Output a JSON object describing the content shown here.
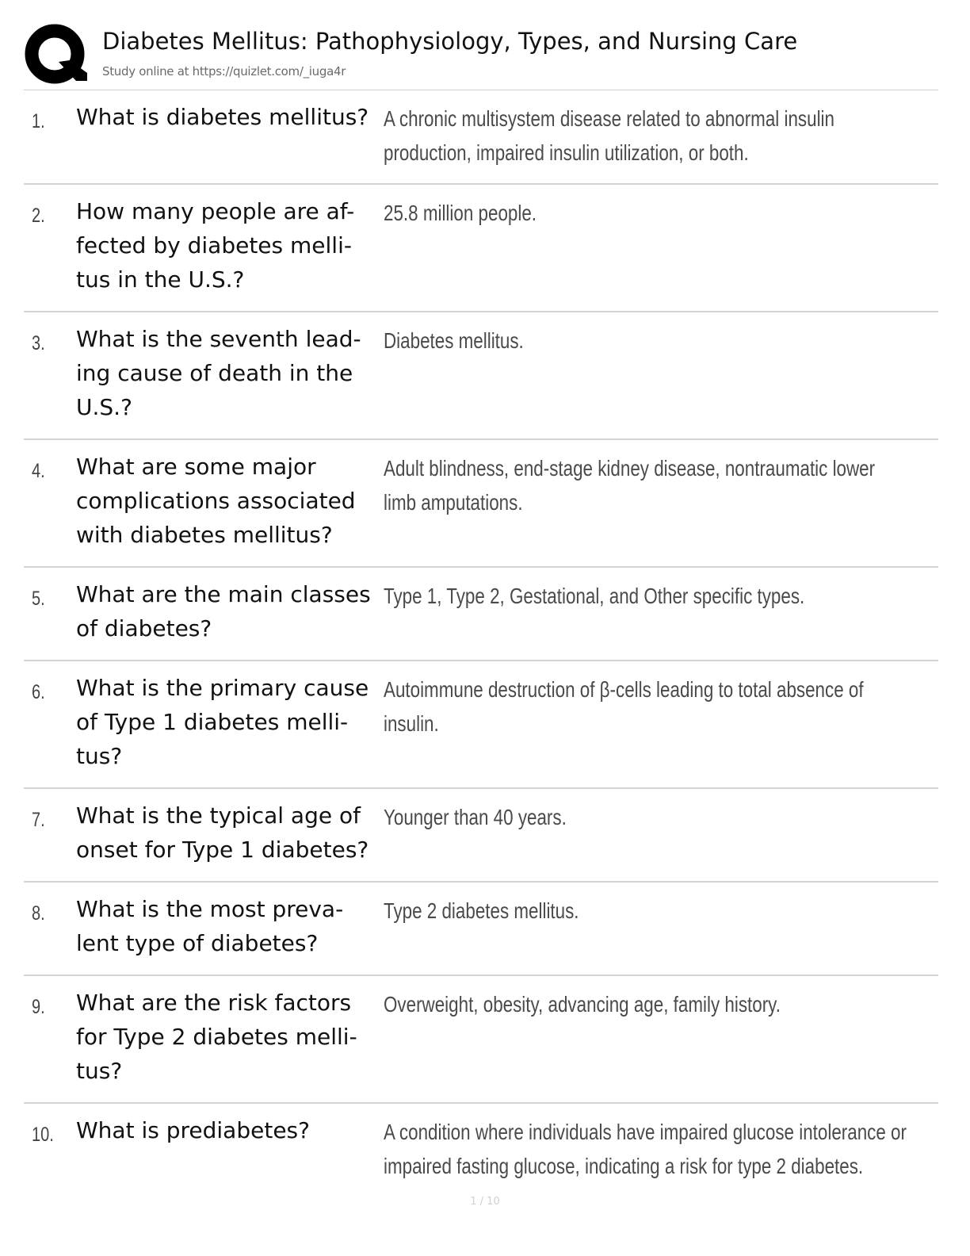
{
  "header": {
    "logo_icon": "quizlet-q-logo-icon",
    "title": "Diabetes Mellitus: Pathophysiology, Types, and Nursing Care",
    "subtitle": "Study online at https://quizlet.com/_iuga4r"
  },
  "cards": [
    {
      "number": "1.",
      "term": "What is diabetes mellitus?",
      "definition": "A chronic multisystem disease related to abnormal insulin production, impaired insulin utilization, or both."
    },
    {
      "number": "2.",
      "term": "How many people are af-fected by diabetes melli-tus in the U.S.?",
      "definition": "25.8 million people."
    },
    {
      "number": "3.",
      "term": "What is the seventh lead-ing cause of death in the U.S.?",
      "definition": "Diabetes mellitus."
    },
    {
      "number": "4.",
      "term": "What are some major complications associated with diabetes mellitus?",
      "definition": "Adult blindness, end-stage kidney disease, nontraumatic lower limb amputations."
    },
    {
      "number": "5.",
      "term": "What are the main classes of diabetes?",
      "definition": "Type 1, Type 2, Gestational, and Other specific types."
    },
    {
      "number": "6.",
      "term": "What is the primary cause of Type 1 diabetes melli-tus?",
      "definition": "Autoimmune destruction of β-cells leading to total absence of insulin."
    },
    {
      "number": "7.",
      "term": "What is the typical age of onset for Type 1 diabetes?",
      "definition": "Younger than 40 years."
    },
    {
      "number": "8.",
      "term": "What is the most preva-lent type of diabetes?",
      "definition": "Type 2 diabetes mellitus."
    },
    {
      "number": "9.",
      "term": "What are the risk factors for Type 2 diabetes melli-tus?",
      "definition": "Overweight, obesity, advancing age, family history."
    },
    {
      "number": "10.",
      "term": "What is prediabetes?",
      "definition": "A condition where individuals have impaired glucose intolerance or impaired fasting glucose, indicating a risk for type 2 diabetes."
    }
  ],
  "footer": {
    "page_number": "1 / 10"
  }
}
